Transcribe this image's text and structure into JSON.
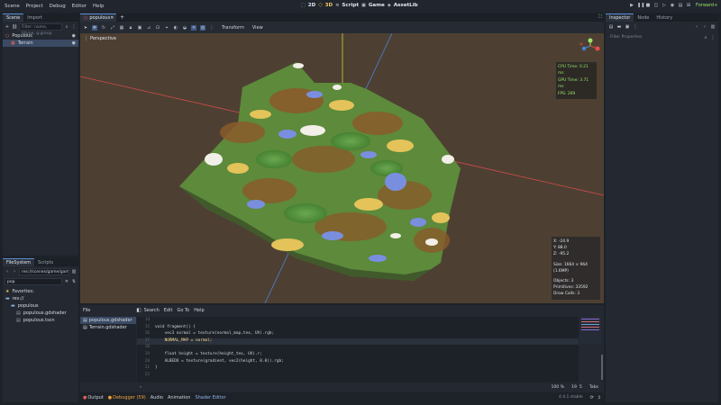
{
  "menubar": {
    "menus": [
      "Scene",
      "Project",
      "Debug",
      "Editor",
      "Help"
    ],
    "modes": [
      "2D",
      "3D",
      "Script",
      "Game",
      "AssetLib"
    ],
    "renderer": "Forward+"
  },
  "left_top": {
    "tabs": [
      "Scene",
      "Import"
    ],
    "filter_placeholder": "Filter: name, t:type, g:group",
    "tree": [
      {
        "label": "Populous",
        "type": "node3d"
      },
      {
        "label": "Terrain",
        "type": "mesh"
      }
    ]
  },
  "left_bottom": {
    "tabs": [
      "FileSystem",
      "Scripts"
    ],
    "path": "res://scenes/game/game.tscn",
    "search_value": "pop",
    "tree": [
      {
        "label": "Favorites:"
      },
      {
        "label": "res://"
      },
      {
        "label": "populous"
      },
      {
        "label": "populous.gdshader"
      },
      {
        "label": "populous.tscn"
      }
    ]
  },
  "editor_tabs": {
    "open": "populous"
  },
  "viewport_toolbar": {
    "transform": "Transform",
    "view": "View"
  },
  "viewport": {
    "perspective": "Perspective",
    "perf": [
      "CPU Time: 0.21 ms",
      "GPU Time: 3.71 ms",
      "FPS: 269"
    ],
    "rot": [
      "X: -24.9",
      "Y: 88.0",
      "Z: -95.2"
    ],
    "size": "Size: 1664 × 964 (1.6MP)",
    "stats": [
      "Objects: 3",
      "Primitives: 33592",
      "Draw Calls: 3"
    ]
  },
  "shader_editor": {
    "menus": [
      "File",
      "Search",
      "Edit",
      "Go To",
      "Help"
    ],
    "files": [
      "populous.gdshader",
      "Terrain.gdshader"
    ],
    "lines": [
      {
        "n": "14",
        "code": ""
      },
      {
        "n": "15",
        "code": "void fragment() {"
      },
      {
        "n": "16",
        "code": "    vec3 normal = texture(normal_map,tex, UV).rgb;"
      },
      {
        "n": "17",
        "code": "    NORMAL_MAP = normal;"
      },
      {
        "n": "18",
        "code": ""
      },
      {
        "n": "19",
        "code": "    float height = texture(height_tex, UV).r;"
      },
      {
        "n": "20",
        "code": "    ALBEDO = texture(gradient, vec2(height, 0.0)).rgb;"
      },
      {
        "n": "21",
        "code": "}"
      },
      {
        "n": "22",
        "code": ""
      }
    ],
    "status": {
      "zoom": "100 %",
      "line": "19",
      "col": "5",
      "indent": "Tabs"
    }
  },
  "bottom_tabs": [
    "Output",
    "Debugger (59)",
    "Audio",
    "Animation",
    "Shader Editor"
  ],
  "version": "4.4.1.stable",
  "right": {
    "tabs": [
      "Inspector",
      "Node",
      "History"
    ],
    "filter_placeholder": "Filter Properties"
  },
  "colors": {
    "accent": "#5b8fd6",
    "axis_red": "#d24a4a",
    "axis_green": "#c4d93a",
    "axis_blue": "#4a83d6",
    "debugger_warn": "#f0a33a"
  },
  "icons": {
    "play": "play-icon",
    "pause": "pause-icon",
    "stop": "stop-icon"
  }
}
